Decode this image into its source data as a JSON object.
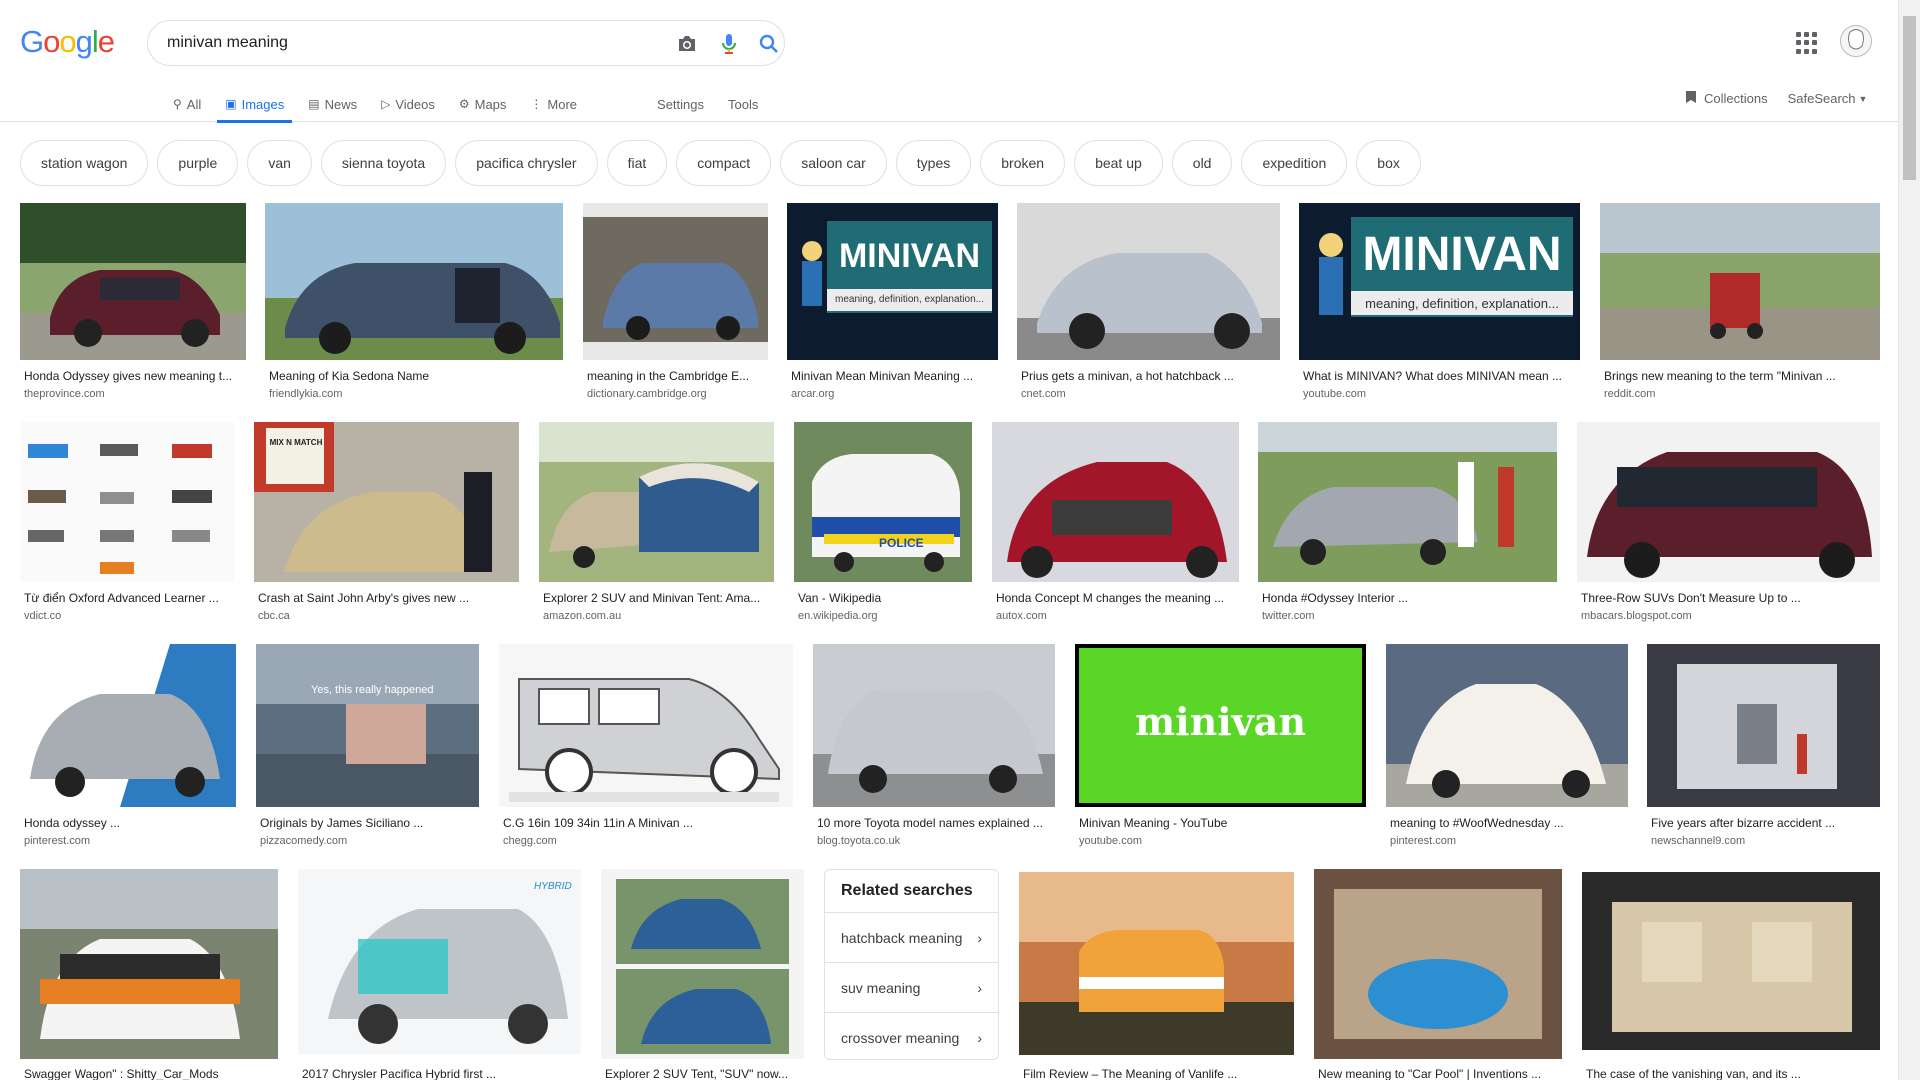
{
  "logo": [
    "G",
    "o",
    "o",
    "g",
    "l",
    "e"
  ],
  "logo_colors": [
    "#4285f4",
    "#ea4335",
    "#fbbc05",
    "#4285f4",
    "#34a853",
    "#ea4335"
  ],
  "search": {
    "query": "minivan meaning"
  },
  "tabs": [
    {
      "label": "All",
      "icon": "search-icon"
    },
    {
      "label": "Images",
      "icon": "image-icon",
      "active": true
    },
    {
      "label": "News",
      "icon": "news-icon"
    },
    {
      "label": "Videos",
      "icon": "video-icon"
    },
    {
      "label": "Maps",
      "icon": "map-icon"
    },
    {
      "label": "More",
      "icon": "more-icon"
    },
    {
      "label": "Settings"
    },
    {
      "label": "Tools"
    }
  ],
  "header_right": {
    "collections": "Collections",
    "safesearch": "SafeSearch"
  },
  "chips": [
    "station wagon",
    "purple",
    "van",
    "sienna toyota",
    "pacifica chrysler",
    "fiat",
    "compact",
    "saloon car",
    "types",
    "broken",
    "beat up",
    "old",
    "expedition",
    "box"
  ],
  "results": [
    {
      "caption": "Honda Odyssey gives new meaning t...",
      "source": "theprovince.com"
    },
    {
      "caption": "Meaning of Kia Sedona Name",
      "source": "friendlykia.com"
    },
    {
      "caption": "meaning in the Cambridge E...",
      "source": "dictionary.cambridge.org"
    },
    {
      "caption": "Minivan Mean Minivan Meaning ...",
      "source": "arcar.org"
    },
    {
      "caption": "Prius gets a minivan, a hot hatchback ...",
      "source": "cnet.com"
    },
    {
      "caption": "What is MINIVAN? What does MINIVAN mean ...",
      "source": "youtube.com"
    },
    {
      "caption": "Brings new meaning to the term \"Minivan ...",
      "source": "reddit.com"
    },
    {
      "caption": "Từ điển Oxford Advanced Learner ...",
      "source": "vdict.co"
    },
    {
      "caption": "Crash at Saint John Arby's gives new ...",
      "source": "cbc.ca"
    },
    {
      "caption": "Explorer 2 SUV and Minivan Tent: Ama...",
      "source": "amazon.com.au"
    },
    {
      "caption": "Van - Wikipedia",
      "source": "en.wikipedia.org"
    },
    {
      "caption": "Honda Concept M changes the meaning ...",
      "source": "autox.com"
    },
    {
      "caption": "Honda #Odyssey Interior ...",
      "source": "twitter.com"
    },
    {
      "caption": "Three-Row SUVs Don't Measure Up to ...",
      "source": "mbacars.blogspot.com"
    },
    {
      "caption": "Honda odyssey ...",
      "source": "pinterest.com"
    },
    {
      "caption": "Originals by James Siciliano ...",
      "source": "pizzacomedy.com"
    },
    {
      "caption": "C.G 16in 109 34in 11in A Minivan ...",
      "source": "chegg.com"
    },
    {
      "caption": "10 more Toyota model names explained ...",
      "source": "blog.toyota.co.uk"
    },
    {
      "caption": "Minivan Meaning - YouTube",
      "source": "youtube.com"
    },
    {
      "caption": "meaning to #WoofWednesday ...",
      "source": "pinterest.com"
    },
    {
      "caption": "Five years after bizarre accident ...",
      "source": "newschannel9.com"
    },
    {
      "caption": "Swagger Wagon\" : Shitty_Car_Mods",
      "source": ""
    },
    {
      "caption": "2017 Chrysler Pacifica Hybrid first ...",
      "source": ""
    },
    {
      "caption": "Explorer 2 SUV Tent, \"SUV\" now...",
      "source": ""
    },
    {
      "caption": "Film Review – The Meaning of Vanlife ...",
      "source": ""
    },
    {
      "caption": "New meaning to \"Car Pool\" | Inventions ...",
      "source": ""
    },
    {
      "caption": "The case of the vanishing van, and its ...",
      "source": ""
    }
  ],
  "thumb_text": {
    "minivan_banner": "MINIVAN",
    "minivan_sub": "meaning, definition, explanation...",
    "youtube_word": "minivan",
    "police": "POLICE",
    "sign": "MIX N MATCH",
    "hybrid": "HYBRID",
    "caption_overlay": "Yes, this really happened"
  },
  "related": {
    "title": "Related searches",
    "items": [
      "hatchback meaning",
      "suv meaning",
      "crossover meaning"
    ]
  },
  "colors": {
    "accent": "#1a73e8",
    "link": "#202124",
    "muted": "#5f6368"
  }
}
